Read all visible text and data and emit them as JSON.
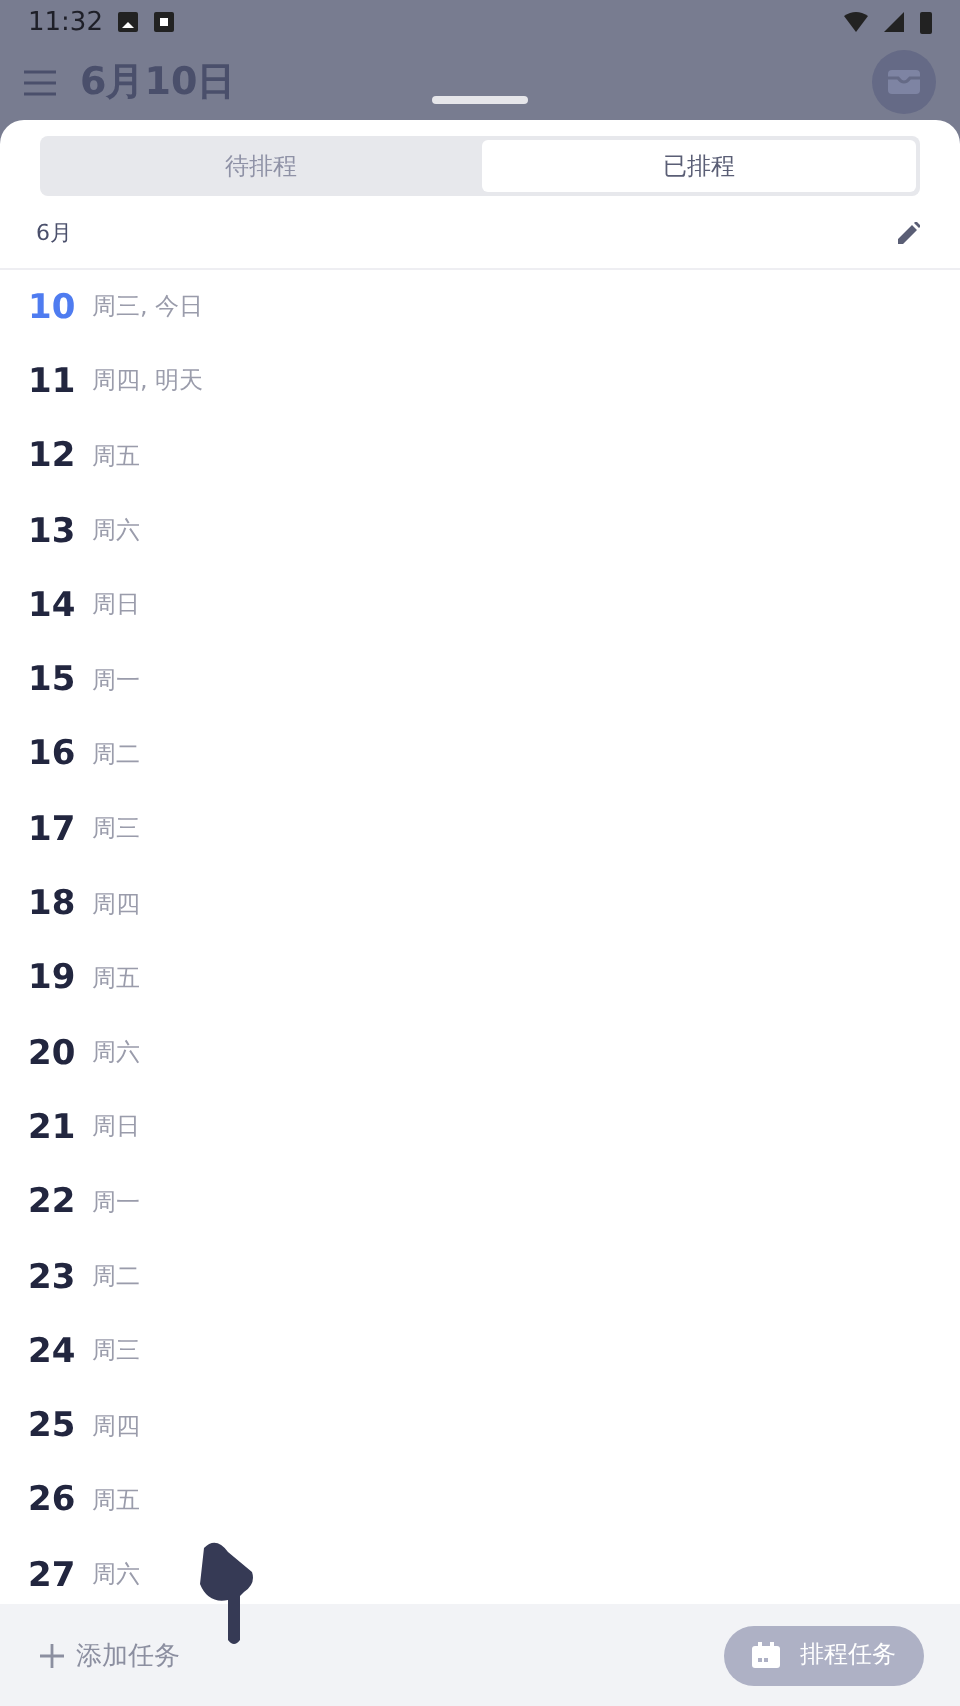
{
  "status_bar": {
    "time": "11:32"
  },
  "header": {
    "title": "6月10日"
  },
  "tabs": [
    {
      "label": "待排程",
      "selected": false
    },
    {
      "label": "已排程",
      "selected": true
    }
  ],
  "month": {
    "label": "6月"
  },
  "days": [
    {
      "day": "10",
      "weekday": "周三, 今日",
      "today": true
    },
    {
      "day": "11",
      "weekday": "周四, 明天",
      "today": false
    },
    {
      "day": "12",
      "weekday": "周五",
      "today": false
    },
    {
      "day": "13",
      "weekday": "周六",
      "today": false
    },
    {
      "day": "14",
      "weekday": "周日",
      "today": false
    },
    {
      "day": "15",
      "weekday": "周一",
      "today": false
    },
    {
      "day": "16",
      "weekday": "周二",
      "today": false
    },
    {
      "day": "17",
      "weekday": "周三",
      "today": false
    },
    {
      "day": "18",
      "weekday": "周四",
      "today": false
    },
    {
      "day": "19",
      "weekday": "周五",
      "today": false
    },
    {
      "day": "20",
      "weekday": "周六",
      "today": false
    },
    {
      "day": "21",
      "weekday": "周日",
      "today": false
    },
    {
      "day": "22",
      "weekday": "周一",
      "today": false
    },
    {
      "day": "23",
      "weekday": "周二",
      "today": false
    },
    {
      "day": "24",
      "weekday": "周三",
      "today": false
    },
    {
      "day": "25",
      "weekday": "周四",
      "today": false
    },
    {
      "day": "26",
      "weekday": "周五",
      "today": false
    },
    {
      "day": "27",
      "weekday": "周六",
      "today": false
    }
  ],
  "bottom_bar": {
    "add_label": "添加任务",
    "schedule_button": {
      "label": "排程任务",
      "disabled": true
    }
  }
}
